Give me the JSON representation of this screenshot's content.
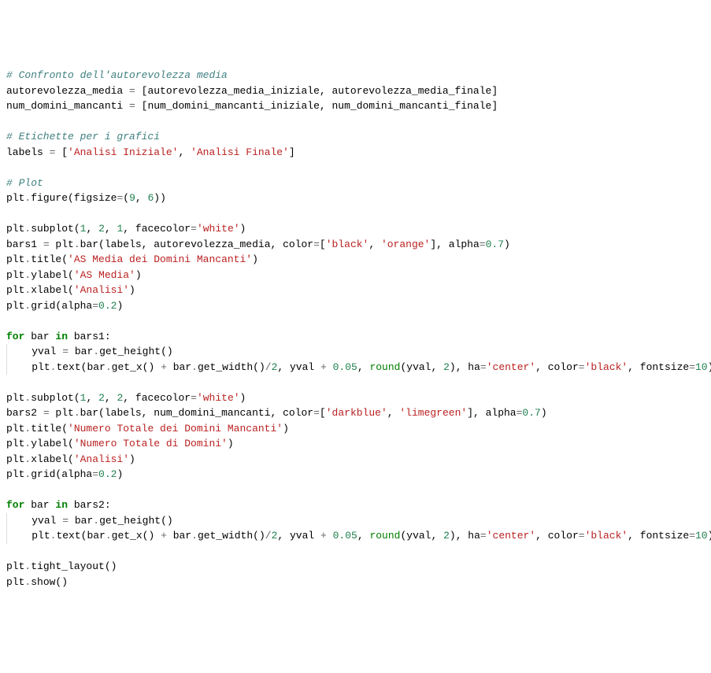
{
  "code": {
    "lines": [
      {
        "indent": 0,
        "tokens": [
          {
            "t": "# Confronto dell'autorevolezza media",
            "c": "c-comment"
          }
        ]
      },
      {
        "indent": 0,
        "tokens": [
          {
            "t": "autorevolezza_media ",
            "c": "c-name"
          },
          {
            "t": "=",
            "c": "c-op"
          },
          {
            "t": " [autorevolezza_media_iniziale, autorevolezza_media_finale]",
            "c": "c-name"
          }
        ]
      },
      {
        "indent": 0,
        "tokens": [
          {
            "t": "num_domini_mancanti ",
            "c": "c-name"
          },
          {
            "t": "=",
            "c": "c-op"
          },
          {
            "t": " [num_domini_mancanti_iniziale, num_domini_mancanti_finale]",
            "c": "c-name"
          }
        ]
      },
      {
        "indent": 0,
        "tokens": []
      },
      {
        "indent": 0,
        "tokens": [
          {
            "t": "# Etichette per i grafici",
            "c": "c-comment"
          }
        ]
      },
      {
        "indent": 0,
        "tokens": [
          {
            "t": "labels ",
            "c": "c-name"
          },
          {
            "t": "=",
            "c": "c-op"
          },
          {
            "t": " [",
            "c": "c-name"
          },
          {
            "t": "'Analisi Iniziale'",
            "c": "c-string"
          },
          {
            "t": ", ",
            "c": "c-name"
          },
          {
            "t": "'Analisi Finale'",
            "c": "c-string"
          },
          {
            "t": "]",
            "c": "c-name"
          }
        ]
      },
      {
        "indent": 0,
        "tokens": []
      },
      {
        "indent": 0,
        "tokens": [
          {
            "t": "# Plot",
            "c": "c-comment"
          }
        ]
      },
      {
        "indent": 0,
        "tokens": [
          {
            "t": "plt",
            "c": "c-name"
          },
          {
            "t": ".",
            "c": "c-op"
          },
          {
            "t": "figure(figsize",
            "c": "c-name"
          },
          {
            "t": "=",
            "c": "c-op"
          },
          {
            "t": "(",
            "c": "c-name"
          },
          {
            "t": "9",
            "c": "c-number"
          },
          {
            "t": ", ",
            "c": "c-name"
          },
          {
            "t": "6",
            "c": "c-number"
          },
          {
            "t": "))",
            "c": "c-name"
          }
        ]
      },
      {
        "indent": 0,
        "tokens": []
      },
      {
        "indent": 0,
        "tokens": [
          {
            "t": "plt",
            "c": "c-name"
          },
          {
            "t": ".",
            "c": "c-op"
          },
          {
            "t": "subplot(",
            "c": "c-name"
          },
          {
            "t": "1",
            "c": "c-number"
          },
          {
            "t": ", ",
            "c": "c-name"
          },
          {
            "t": "2",
            "c": "c-number"
          },
          {
            "t": ", ",
            "c": "c-name"
          },
          {
            "t": "1",
            "c": "c-number"
          },
          {
            "t": ", facecolor",
            "c": "c-name"
          },
          {
            "t": "=",
            "c": "c-op"
          },
          {
            "t": "'white'",
            "c": "c-string"
          },
          {
            "t": ")",
            "c": "c-name"
          }
        ]
      },
      {
        "indent": 0,
        "tokens": [
          {
            "t": "bars1 ",
            "c": "c-name"
          },
          {
            "t": "=",
            "c": "c-op"
          },
          {
            "t": " plt",
            "c": "c-name"
          },
          {
            "t": ".",
            "c": "c-op"
          },
          {
            "t": "bar(labels, autorevolezza_media, color",
            "c": "c-name"
          },
          {
            "t": "=",
            "c": "c-op"
          },
          {
            "t": "[",
            "c": "c-name"
          },
          {
            "t": "'black'",
            "c": "c-string"
          },
          {
            "t": ", ",
            "c": "c-name"
          },
          {
            "t": "'orange'",
            "c": "c-string"
          },
          {
            "t": "], alpha",
            "c": "c-name"
          },
          {
            "t": "=",
            "c": "c-op"
          },
          {
            "t": "0.7",
            "c": "c-number"
          },
          {
            "t": ")",
            "c": "c-name"
          }
        ]
      },
      {
        "indent": 0,
        "tokens": [
          {
            "t": "plt",
            "c": "c-name"
          },
          {
            "t": ".",
            "c": "c-op"
          },
          {
            "t": "title(",
            "c": "c-name"
          },
          {
            "t": "'AS Media dei Domini Mancanti'",
            "c": "c-string"
          },
          {
            "t": ")",
            "c": "c-name"
          }
        ]
      },
      {
        "indent": 0,
        "tokens": [
          {
            "t": "plt",
            "c": "c-name"
          },
          {
            "t": ".",
            "c": "c-op"
          },
          {
            "t": "ylabel(",
            "c": "c-name"
          },
          {
            "t": "'AS Media'",
            "c": "c-string"
          },
          {
            "t": ")",
            "c": "c-name"
          }
        ]
      },
      {
        "indent": 0,
        "tokens": [
          {
            "t": "plt",
            "c": "c-name"
          },
          {
            "t": ".",
            "c": "c-op"
          },
          {
            "t": "xlabel(",
            "c": "c-name"
          },
          {
            "t": "'Analisi'",
            "c": "c-string"
          },
          {
            "t": ")",
            "c": "c-name"
          }
        ]
      },
      {
        "indent": 0,
        "tokens": [
          {
            "t": "plt",
            "c": "c-name"
          },
          {
            "t": ".",
            "c": "c-op"
          },
          {
            "t": "grid(alpha",
            "c": "c-name"
          },
          {
            "t": "=",
            "c": "c-op"
          },
          {
            "t": "0.2",
            "c": "c-number"
          },
          {
            "t": ")",
            "c": "c-name"
          }
        ]
      },
      {
        "indent": 0,
        "tokens": []
      },
      {
        "indent": 0,
        "tokens": [
          {
            "t": "for",
            "c": "c-keyword"
          },
          {
            "t": " bar ",
            "c": "c-name"
          },
          {
            "t": "in",
            "c": "c-keyword"
          },
          {
            "t": " bars1:",
            "c": "c-name"
          }
        ]
      },
      {
        "indent": 1,
        "tokens": [
          {
            "t": "yval ",
            "c": "c-name"
          },
          {
            "t": "=",
            "c": "c-op"
          },
          {
            "t": " bar",
            "c": "c-name"
          },
          {
            "t": ".",
            "c": "c-op"
          },
          {
            "t": "get_height()",
            "c": "c-name"
          }
        ]
      },
      {
        "indent": 1,
        "tokens": [
          {
            "t": "plt",
            "c": "c-name"
          },
          {
            "t": ".",
            "c": "c-op"
          },
          {
            "t": "text(bar",
            "c": "c-name"
          },
          {
            "t": ".",
            "c": "c-op"
          },
          {
            "t": "get_x() ",
            "c": "c-name"
          },
          {
            "t": "+",
            "c": "c-op"
          },
          {
            "t": " bar",
            "c": "c-name"
          },
          {
            "t": ".",
            "c": "c-op"
          },
          {
            "t": "get_width()",
            "c": "c-name"
          },
          {
            "t": "/",
            "c": "c-op"
          },
          {
            "t": "2",
            "c": "c-number"
          },
          {
            "t": ", yval ",
            "c": "c-name"
          },
          {
            "t": "+",
            "c": "c-op"
          },
          {
            "t": " ",
            "c": "c-name"
          },
          {
            "t": "0.05",
            "c": "c-number"
          },
          {
            "t": ", ",
            "c": "c-name"
          },
          {
            "t": "round",
            "c": "c-builtin"
          },
          {
            "t": "(yval, ",
            "c": "c-name"
          },
          {
            "t": "2",
            "c": "c-number"
          },
          {
            "t": "), ha",
            "c": "c-name"
          },
          {
            "t": "=",
            "c": "c-op"
          },
          {
            "t": "'center'",
            "c": "c-string"
          },
          {
            "t": ", color",
            "c": "c-name"
          },
          {
            "t": "=",
            "c": "c-op"
          },
          {
            "t": "'black'",
            "c": "c-string"
          },
          {
            "t": ", fontsize",
            "c": "c-name"
          },
          {
            "t": "=",
            "c": "c-op"
          },
          {
            "t": "10",
            "c": "c-number"
          },
          {
            "t": ")",
            "c": "c-name"
          }
        ]
      },
      {
        "indent": 0,
        "tokens": []
      },
      {
        "indent": 0,
        "tokens": [
          {
            "t": "plt",
            "c": "c-name"
          },
          {
            "t": ".",
            "c": "c-op"
          },
          {
            "t": "subplot(",
            "c": "c-name"
          },
          {
            "t": "1",
            "c": "c-number"
          },
          {
            "t": ", ",
            "c": "c-name"
          },
          {
            "t": "2",
            "c": "c-number"
          },
          {
            "t": ", ",
            "c": "c-name"
          },
          {
            "t": "2",
            "c": "c-number"
          },
          {
            "t": ", facecolor",
            "c": "c-name"
          },
          {
            "t": "=",
            "c": "c-op"
          },
          {
            "t": "'white'",
            "c": "c-string"
          },
          {
            "t": ")",
            "c": "c-name"
          }
        ]
      },
      {
        "indent": 0,
        "tokens": [
          {
            "t": "bars2 ",
            "c": "c-name"
          },
          {
            "t": "=",
            "c": "c-op"
          },
          {
            "t": " plt",
            "c": "c-name"
          },
          {
            "t": ".",
            "c": "c-op"
          },
          {
            "t": "bar(labels, num_domini_mancanti, color",
            "c": "c-name"
          },
          {
            "t": "=",
            "c": "c-op"
          },
          {
            "t": "[",
            "c": "c-name"
          },
          {
            "t": "'darkblue'",
            "c": "c-string"
          },
          {
            "t": ", ",
            "c": "c-name"
          },
          {
            "t": "'limegreen'",
            "c": "c-string"
          },
          {
            "t": "], alpha",
            "c": "c-name"
          },
          {
            "t": "=",
            "c": "c-op"
          },
          {
            "t": "0.7",
            "c": "c-number"
          },
          {
            "t": ")",
            "c": "c-name"
          }
        ]
      },
      {
        "indent": 0,
        "tokens": [
          {
            "t": "plt",
            "c": "c-name"
          },
          {
            "t": ".",
            "c": "c-op"
          },
          {
            "t": "title(",
            "c": "c-name"
          },
          {
            "t": "'Numero Totale dei Domini Mancanti'",
            "c": "c-string"
          },
          {
            "t": ")",
            "c": "c-name"
          }
        ]
      },
      {
        "indent": 0,
        "tokens": [
          {
            "t": "plt",
            "c": "c-name"
          },
          {
            "t": ".",
            "c": "c-op"
          },
          {
            "t": "ylabel(",
            "c": "c-name"
          },
          {
            "t": "'Numero Totale di Domini'",
            "c": "c-string"
          },
          {
            "t": ")",
            "c": "c-name"
          }
        ]
      },
      {
        "indent": 0,
        "tokens": [
          {
            "t": "plt",
            "c": "c-name"
          },
          {
            "t": ".",
            "c": "c-op"
          },
          {
            "t": "xlabel(",
            "c": "c-name"
          },
          {
            "t": "'Analisi'",
            "c": "c-string"
          },
          {
            "t": ")",
            "c": "c-name"
          }
        ]
      },
      {
        "indent": 0,
        "tokens": [
          {
            "t": "plt",
            "c": "c-name"
          },
          {
            "t": ".",
            "c": "c-op"
          },
          {
            "t": "grid(alpha",
            "c": "c-name"
          },
          {
            "t": "=",
            "c": "c-op"
          },
          {
            "t": "0.2",
            "c": "c-number"
          },
          {
            "t": ")",
            "c": "c-name"
          }
        ]
      },
      {
        "indent": 0,
        "tokens": []
      },
      {
        "indent": 0,
        "tokens": [
          {
            "t": "for",
            "c": "c-keyword"
          },
          {
            "t": " bar ",
            "c": "c-name"
          },
          {
            "t": "in",
            "c": "c-keyword"
          },
          {
            "t": " bars2:",
            "c": "c-name"
          }
        ]
      },
      {
        "indent": 1,
        "tokens": [
          {
            "t": "yval ",
            "c": "c-name"
          },
          {
            "t": "=",
            "c": "c-op"
          },
          {
            "t": " bar",
            "c": "c-name"
          },
          {
            "t": ".",
            "c": "c-op"
          },
          {
            "t": "get_height()",
            "c": "c-name"
          }
        ]
      },
      {
        "indent": 1,
        "tokens": [
          {
            "t": "plt",
            "c": "c-name"
          },
          {
            "t": ".",
            "c": "c-op"
          },
          {
            "t": "text(bar",
            "c": "c-name"
          },
          {
            "t": ".",
            "c": "c-op"
          },
          {
            "t": "get_x() ",
            "c": "c-name"
          },
          {
            "t": "+",
            "c": "c-op"
          },
          {
            "t": " bar",
            "c": "c-name"
          },
          {
            "t": ".",
            "c": "c-op"
          },
          {
            "t": "get_width()",
            "c": "c-name"
          },
          {
            "t": "/",
            "c": "c-op"
          },
          {
            "t": "2",
            "c": "c-number"
          },
          {
            "t": ", yval ",
            "c": "c-name"
          },
          {
            "t": "+",
            "c": "c-op"
          },
          {
            "t": " ",
            "c": "c-name"
          },
          {
            "t": "0.05",
            "c": "c-number"
          },
          {
            "t": ", ",
            "c": "c-name"
          },
          {
            "t": "round",
            "c": "c-builtin"
          },
          {
            "t": "(yval, ",
            "c": "c-name"
          },
          {
            "t": "2",
            "c": "c-number"
          },
          {
            "t": "), ha",
            "c": "c-name"
          },
          {
            "t": "=",
            "c": "c-op"
          },
          {
            "t": "'center'",
            "c": "c-string"
          },
          {
            "t": ", color",
            "c": "c-name"
          },
          {
            "t": "=",
            "c": "c-op"
          },
          {
            "t": "'black'",
            "c": "c-string"
          },
          {
            "t": ", fontsize",
            "c": "c-name"
          },
          {
            "t": "=",
            "c": "c-op"
          },
          {
            "t": "10",
            "c": "c-number"
          },
          {
            "t": ")",
            "c": "c-name"
          }
        ]
      },
      {
        "indent": 0,
        "tokens": []
      },
      {
        "indent": 0,
        "tokens": [
          {
            "t": "plt",
            "c": "c-name"
          },
          {
            "t": ".",
            "c": "c-op"
          },
          {
            "t": "tight_layout()",
            "c": "c-name"
          }
        ]
      },
      {
        "indent": 0,
        "tokens": [
          {
            "t": "plt",
            "c": "c-name"
          },
          {
            "t": ".",
            "c": "c-op"
          },
          {
            "t": "show()",
            "c": "c-name"
          }
        ]
      }
    ]
  }
}
